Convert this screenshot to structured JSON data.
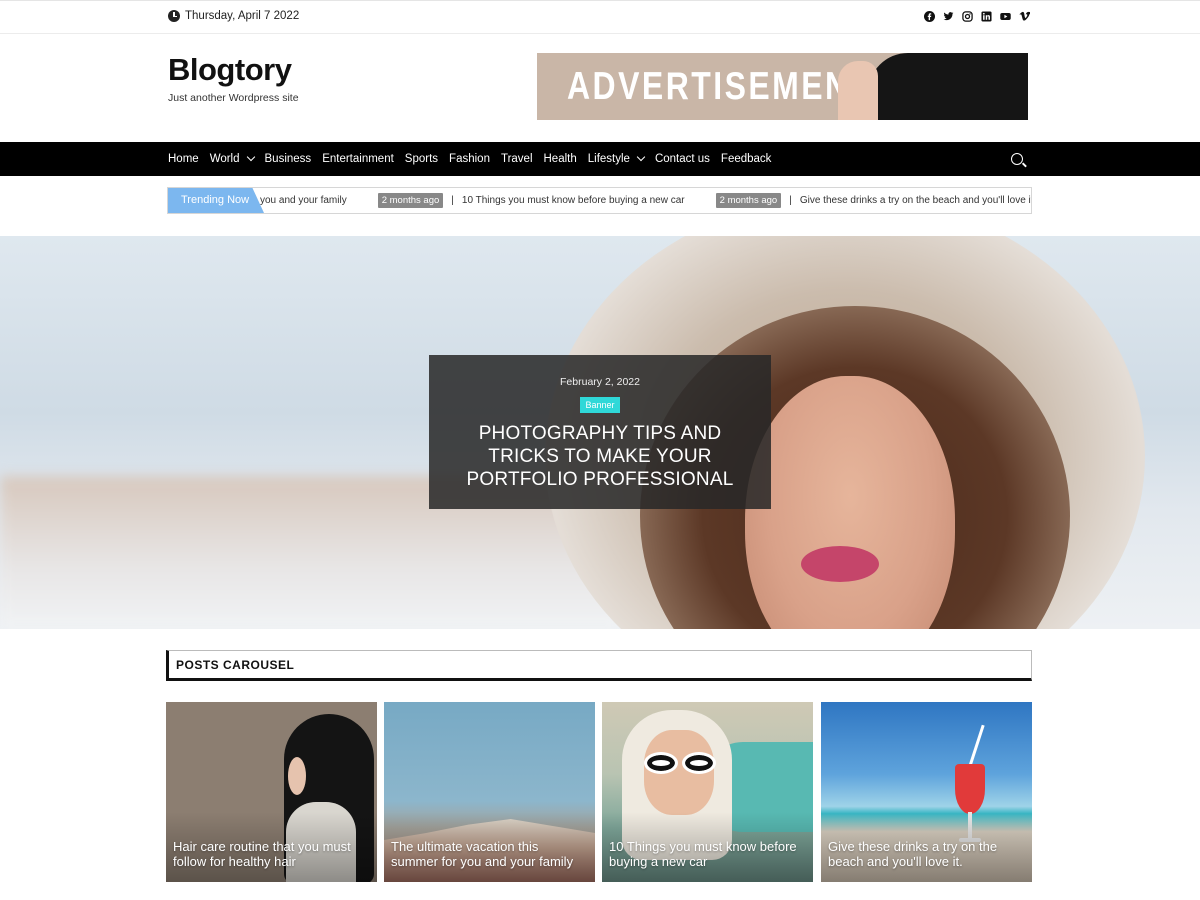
{
  "topbar": {
    "date": "Thursday, April 7 2022",
    "socials": [
      "facebook-icon",
      "twitter-icon",
      "instagram-icon",
      "linkedin-icon",
      "youtube-icon",
      "vimeo-icon"
    ]
  },
  "header": {
    "site_title": "Blogtory",
    "tagline": "Just another Wordpress site",
    "ad_text": "ADVERTISEMENT"
  },
  "nav": {
    "items": [
      {
        "label": "Home"
      },
      {
        "label": "World"
      },
      {
        "label": "Business"
      },
      {
        "label": "Entertainment"
      },
      {
        "label": "Sports"
      },
      {
        "label": "Fashion"
      },
      {
        "label": "Travel"
      },
      {
        "label": "Health"
      },
      {
        "label": "Lifestyle"
      },
      {
        "label": "Contact us"
      },
      {
        "label": "Feedback"
      }
    ]
  },
  "ticker": {
    "label": "Trending Now",
    "items": [
      {
        "title": "you and your family",
        "ago": "2 months ago"
      },
      {
        "title": "10 Things you must know before buying a new car",
        "ago": "2 months ago"
      },
      {
        "title": "Give these drinks a try on the beach and you'll love it.",
        "ago": ""
      }
    ]
  },
  "hero": {
    "date": "February 2, 2022",
    "category": "Banner",
    "title": "PHOTOGRAPHY TIPS AND TRICKS TO MAKE YOUR PORTFOLIO PROFESSIONAL"
  },
  "carousel": {
    "heading": "POSTS CAROUSEL",
    "posts": [
      {
        "title": "Hair care routine that you must follow for healthy hair"
      },
      {
        "title": "The ultimate vacation this summer for you and your family"
      },
      {
        "title": "10 Things you must know before buying a new car"
      },
      {
        "title": "Give these drinks a try on the beach and you'll love it."
      }
    ]
  },
  "colors": {
    "nav_bg": "#000000",
    "trending_badge": "#7cb7ef",
    "category_badge": "#2fd8d8"
  }
}
